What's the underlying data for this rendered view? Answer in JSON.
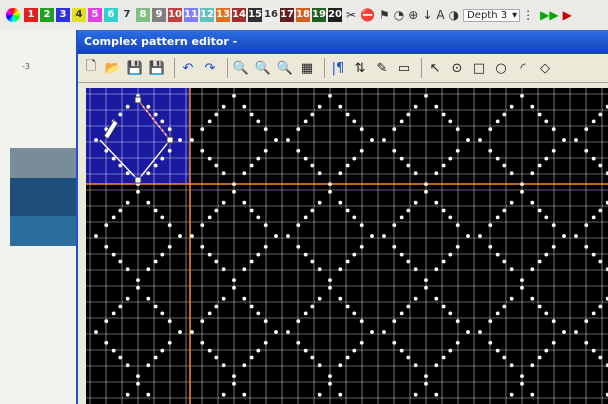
{
  "topbar": {
    "swatches": [
      {
        "label": "1",
        "color": "#e02020"
      },
      {
        "label": "2",
        "color": "#20a020"
      },
      {
        "label": "3",
        "color": "#3030e0"
      },
      {
        "label": "4",
        "color": "#e0e020"
      },
      {
        "label": "5",
        "color": "#e040e0"
      },
      {
        "label": "6",
        "color": "#30d0d0"
      },
      {
        "label": "7",
        "color": "#e8e8e8"
      },
      {
        "label": "8",
        "color": "#80c080"
      },
      {
        "label": "9",
        "color": "#808080"
      },
      {
        "label": "10",
        "color": "#c04040"
      },
      {
        "label": "11",
        "color": "#8080ff"
      },
      {
        "label": "12",
        "color": "#60c0c0"
      },
      {
        "label": "13",
        "color": "#e07020"
      },
      {
        "label": "14",
        "color": "#a03030"
      },
      {
        "label": "15",
        "color": "#303030"
      },
      {
        "label": "16",
        "color": "#f0f0f0"
      },
      {
        "label": "17",
        "color": "#602020"
      },
      {
        "label": "18",
        "color": "#d06020"
      },
      {
        "label": "19",
        "color": "#206020"
      },
      {
        "label": "20",
        "color": "#202020"
      }
    ],
    "depth_label": "Depth 3"
  },
  "background": {
    "line_number": "-3"
  },
  "window": {
    "title": "Complex pattern editor -"
  },
  "toolbar_icons": [
    "new-file-icon",
    "open-folder-icon",
    "save-icon",
    "save-as-icon",
    "undo-icon",
    "redo-icon",
    "zoom-1-icon",
    "zoom-2-icon",
    "zoom-3-icon",
    "grid-icon",
    "mirror-icon",
    "align-icon",
    "pen-icon",
    "eraser-icon",
    "select-icon",
    "circle-point-icon",
    "rectangle-icon",
    "circle-icon",
    "arc-icon",
    "diamond-icon"
  ],
  "toolbar_glyphs": [
    "🗋",
    "📂",
    "💾",
    "💾",
    "↶",
    "↷",
    "🔍",
    "🔍",
    "🔍",
    "▦",
    "|¶",
    "⇅",
    "✎",
    "▭",
    "↖",
    "⊙",
    "□",
    "○",
    "◜",
    "◇"
  ],
  "colors": {
    "grid_bg": "#000000",
    "grid_line": "#ffffff",
    "accent_line": "#ff8c1a",
    "selection": "#1a1aa0"
  }
}
